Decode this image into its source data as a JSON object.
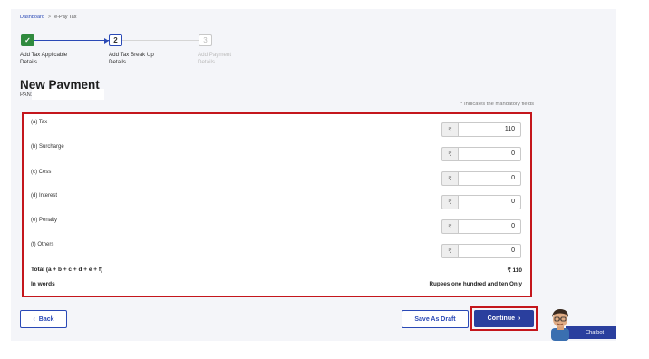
{
  "breadcrumb": {
    "home": "Dashboard",
    "separator": ">",
    "current": "e-Pay Tax"
  },
  "stepper": {
    "steps": [
      {
        "number": "✓",
        "label_line1": "Add Tax Applicable",
        "label_line2": "Details",
        "state": "completed"
      },
      {
        "number": "2",
        "label_line1": "Add Tax Break Up",
        "label_line2": "Details",
        "state": "active"
      },
      {
        "number": "3",
        "label_line1": "Add Payment",
        "label_line2": "Details",
        "state": "pending"
      }
    ]
  },
  "page": {
    "title": "New Payment",
    "pan_label": "PAN:"
  },
  "mandatory_note": "* Indicates the mandatory fields",
  "currency_symbol": "₹",
  "rows": [
    {
      "label": "(a) Tax",
      "value": "110"
    },
    {
      "label": "(b) Surcharge",
      "value": "0"
    },
    {
      "label": "(c) Cess",
      "value": "0"
    },
    {
      "label": "(d) Interest",
      "value": "0"
    },
    {
      "label": "(e) Penalty",
      "value": "0"
    },
    {
      "label": "(f) Others",
      "value": "0"
    }
  ],
  "total": {
    "label": "Total (a + b + c + d + e + f)",
    "value": "₹ 110"
  },
  "in_words": {
    "label": "In words",
    "value": "Rupees one hundred and ten Only"
  },
  "buttons": {
    "back": "Back",
    "back_icon": "‹",
    "save_draft": "Save As Draft",
    "continue": "Continue",
    "continue_icon": "›"
  },
  "chatbot": {
    "label": "Chatbot"
  },
  "colors": {
    "primary": "#2a3f9e",
    "highlight": "#c4161c",
    "success": "#2f8a3e"
  }
}
